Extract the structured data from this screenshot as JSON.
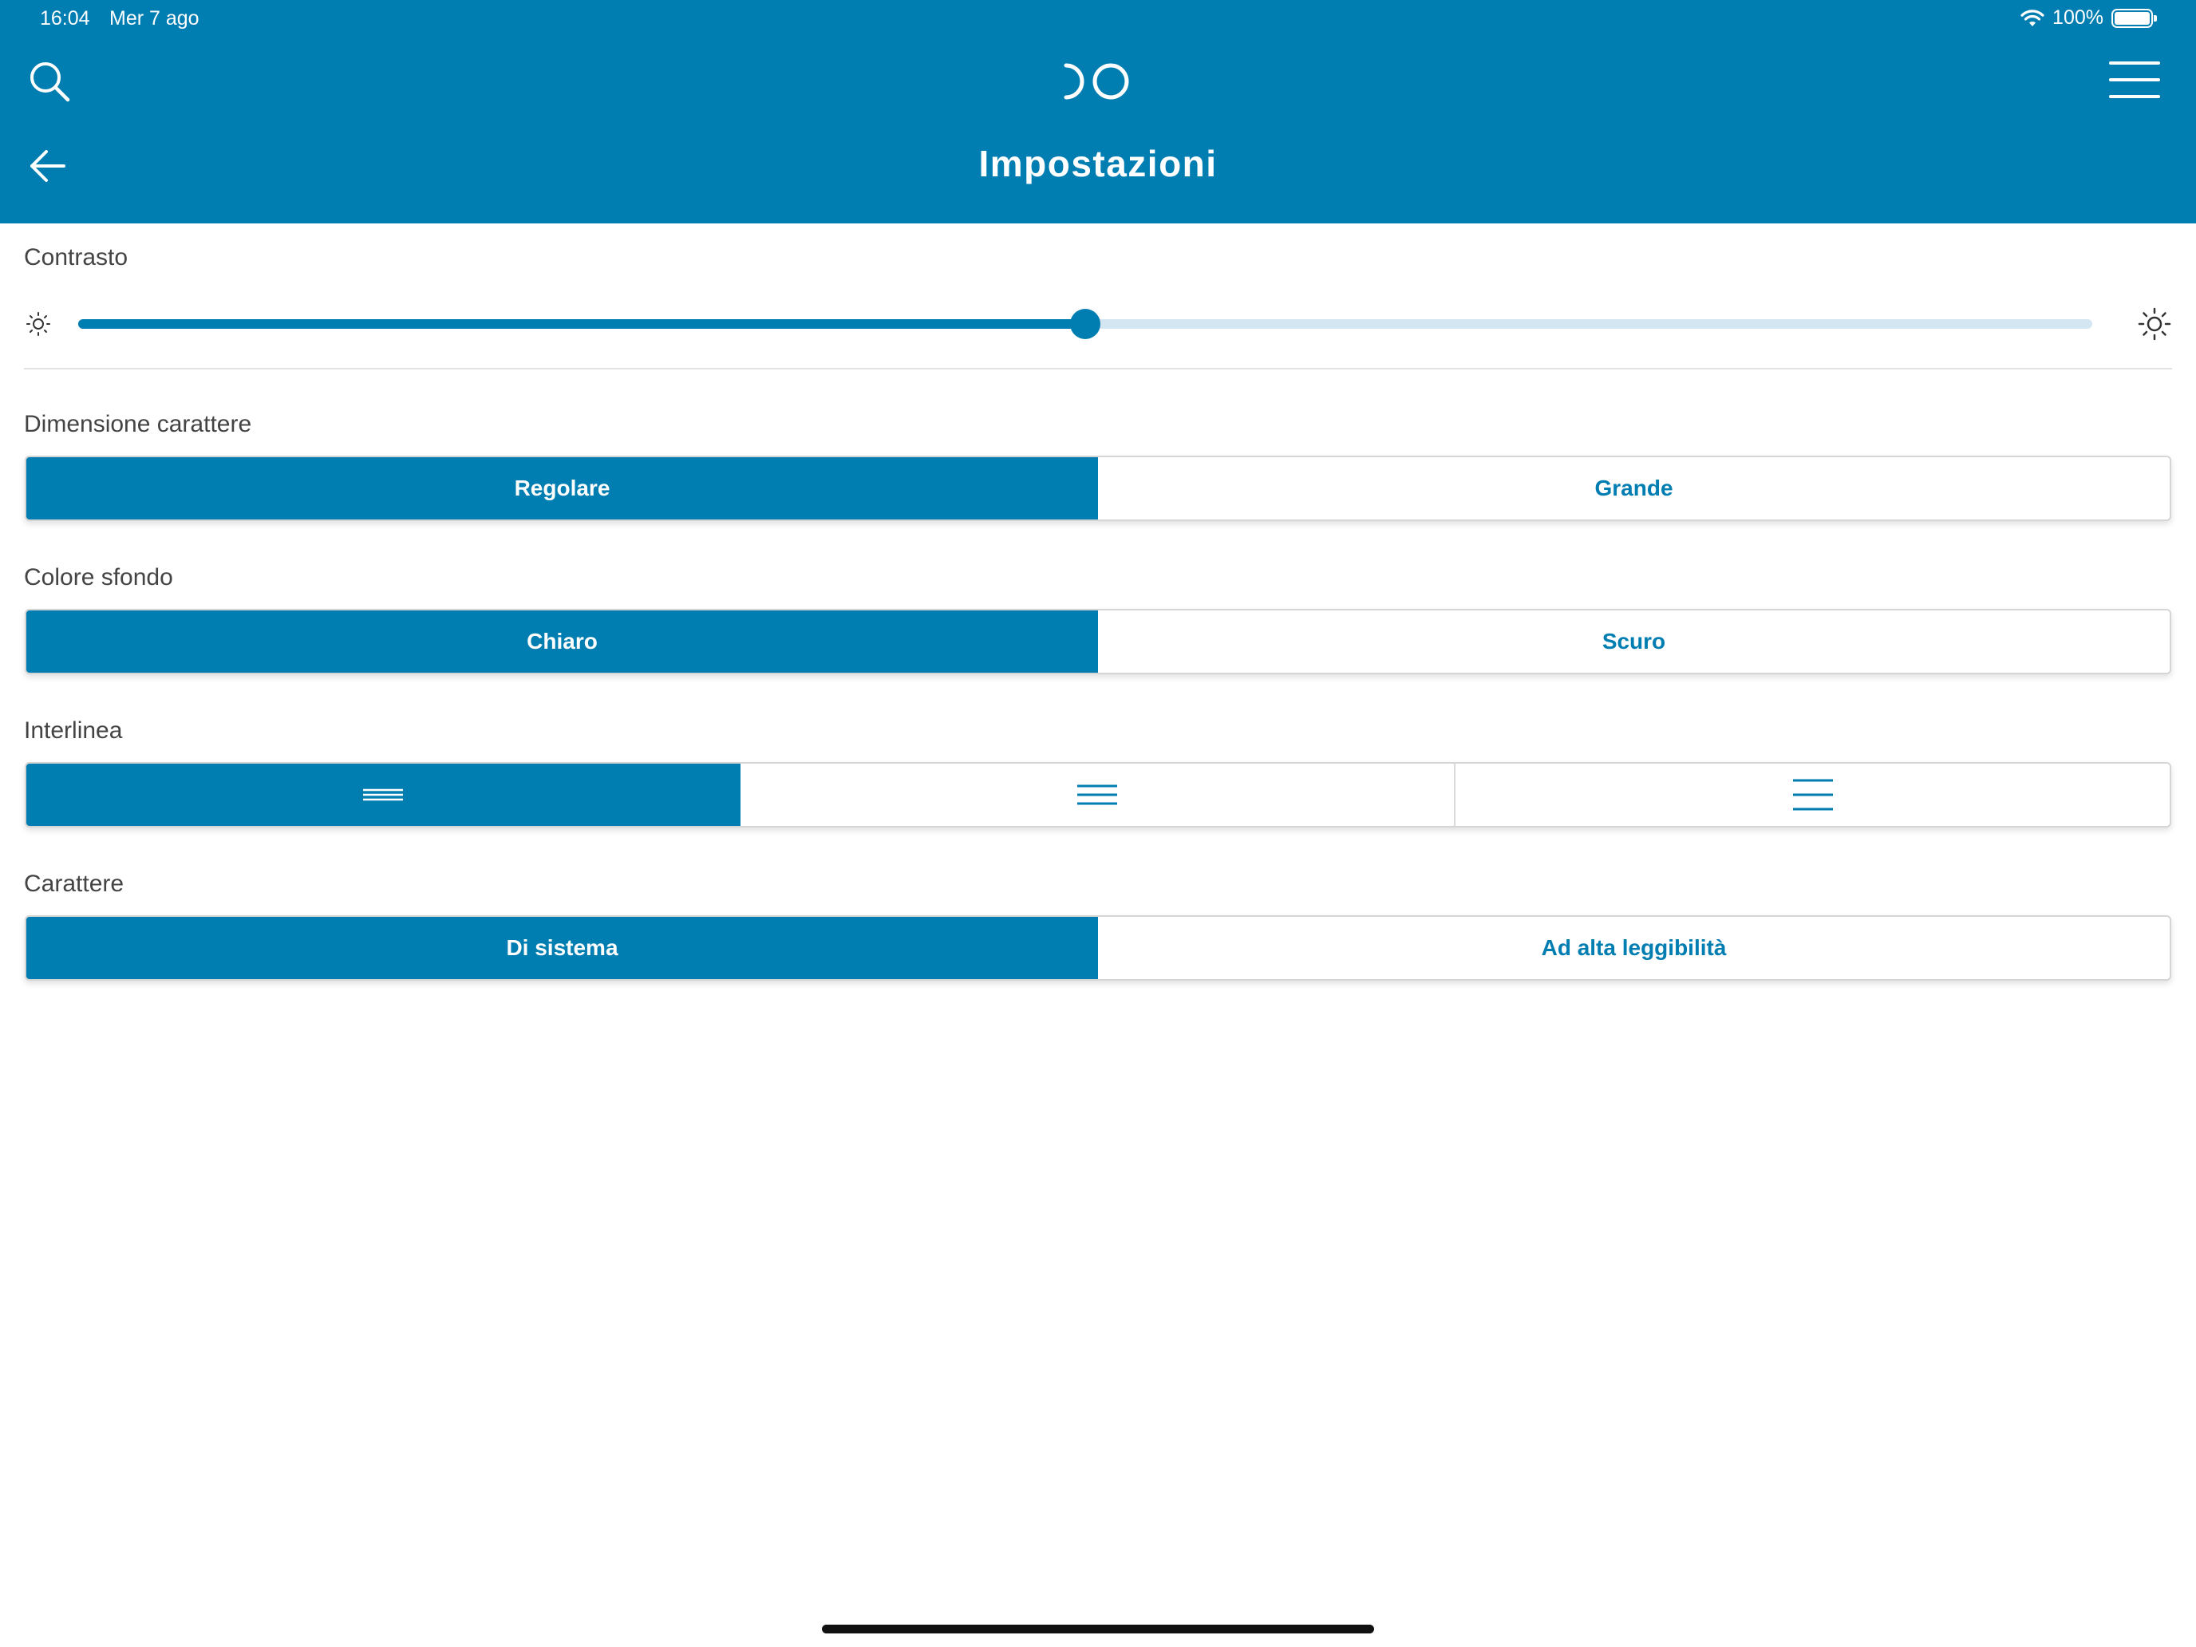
{
  "status_bar": {
    "time": "16:04",
    "date": "Mer 7 ago",
    "battery": "100%"
  },
  "header": {
    "title": "Impostazioni",
    "color": "#007db1"
  },
  "contrast": {
    "label": "Contrasto",
    "value_percent": 50
  },
  "font_size": {
    "label": "Dimensione carattere",
    "options": [
      "Regolare",
      "Grande"
    ],
    "selected": "Regolare"
  },
  "background_color": {
    "label": "Colore sfondo",
    "options": [
      "Chiaro",
      "Scuro"
    ],
    "selected": "Chiaro"
  },
  "line_spacing": {
    "label": "Interlinea",
    "options": [
      "line-spacing-narrow-icon",
      "line-spacing-medium-icon",
      "line-spacing-wide-icon"
    ],
    "selected_index": 0
  },
  "typeface": {
    "label": "Carattere",
    "options": [
      "Di sistema",
      "Ad alta leggibilità"
    ],
    "selected": "Di sistema"
  }
}
